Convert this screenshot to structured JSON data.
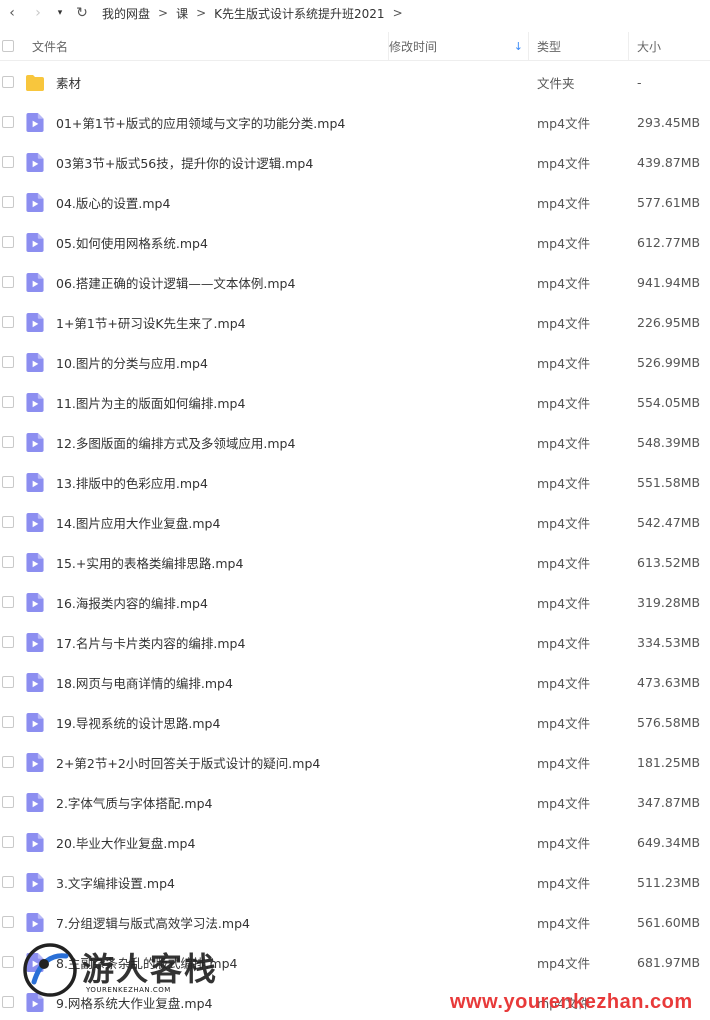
{
  "nav": {
    "back_glyph": "‹",
    "forward_glyph": "›",
    "dropdown_glyph": "▾",
    "refresh_glyph": "↻",
    "breadcrumbs": [
      "我的网盘",
      "课",
      "K先生版式设计系统提升班2021"
    ],
    "separator": ">"
  },
  "header": {
    "name": "文件名",
    "date": "修改时间",
    "type": "类型",
    "size": "大小",
    "sort_glyph": "↓"
  },
  "colors": {
    "folder": "#f8c63d",
    "video_icon": "#8c8ef0",
    "accent": "#3b8bf6",
    "watermark_red": "#e83a3a"
  },
  "files": [
    {
      "name": "素材",
      "type": "文件夹",
      "size": "-",
      "icon": "folder-icon"
    },
    {
      "name": "01+第1节+版式的应用领域与文字的功能分类.mp4",
      "type": "mp4文件",
      "size": "293.45MB",
      "icon": "video-file-icon"
    },
    {
      "name": "03第3节+版式56技，提升你的设计逻辑.mp4",
      "type": "mp4文件",
      "size": "439.87MB",
      "icon": "video-file-icon"
    },
    {
      "name": "04.版心的设置.mp4",
      "type": "mp4文件",
      "size": "577.61MB",
      "icon": "video-file-icon"
    },
    {
      "name": "05.如何使用网格系统.mp4",
      "type": "mp4文件",
      "size": "612.77MB",
      "icon": "video-file-icon"
    },
    {
      "name": "06.搭建正确的设计逻辑——文本体例.mp4",
      "type": "mp4文件",
      "size": "941.94MB",
      "icon": "video-file-icon"
    },
    {
      "name": "1+第1节+研习设K先生来了.mp4",
      "type": "mp4文件",
      "size": "226.95MB",
      "icon": "video-file-icon"
    },
    {
      "name": "10.图片的分类与应用.mp4",
      "type": "mp4文件",
      "size": "526.99MB",
      "icon": "video-file-icon"
    },
    {
      "name": "11.图片为主的版面如何编排.mp4",
      "type": "mp4文件",
      "size": "554.05MB",
      "icon": "video-file-icon"
    },
    {
      "name": "12.多图版面的编排方式及多领域应用.mp4",
      "type": "mp4文件",
      "size": "548.39MB",
      "icon": "video-file-icon"
    },
    {
      "name": "13.排版中的色彩应用.mp4",
      "type": "mp4文件",
      "size": "551.58MB",
      "icon": "video-file-icon"
    },
    {
      "name": "14.图片应用大作业复盘.mp4",
      "type": "mp4文件",
      "size": "542.47MB",
      "icon": "video-file-icon"
    },
    {
      "name": "15.+实用的表格类编排思路.mp4",
      "type": "mp4文件",
      "size": "613.52MB",
      "icon": "video-file-icon"
    },
    {
      "name": "16.海报类内容的编排.mp4",
      "type": "mp4文件",
      "size": "319.28MB",
      "icon": "video-file-icon"
    },
    {
      "name": "17.名片与卡片类内容的编排.mp4",
      "type": "mp4文件",
      "size": "334.53MB",
      "icon": "video-file-icon"
    },
    {
      "name": "18.网页与电商详情的编排.mp4",
      "type": "mp4文件",
      "size": "473.63MB",
      "icon": "video-file-icon"
    },
    {
      "name": "19.导视系统的设计思路.mp4",
      "type": "mp4文件",
      "size": "576.58MB",
      "icon": "video-file-icon"
    },
    {
      "name": "2+第2节+2小时回答关于版式设计的疑问.mp4",
      "type": "mp4文件",
      "size": "181.25MB",
      "icon": "video-file-icon"
    },
    {
      "name": "2.字体气质与字体搭配.mp4",
      "type": "mp4文件",
      "size": "347.87MB",
      "icon": "video-file-icon"
    },
    {
      "name": "20.毕业大作业复盘.mp4",
      "type": "mp4文件",
      "size": "649.34MB",
      "icon": "video-file-icon"
    },
    {
      "name": "3.文字编排设置.mp4",
      "type": "mp4文件",
      "size": "511.23MB",
      "icon": "video-file-icon"
    },
    {
      "name": "7.分组逻辑与版式高效学习法.mp4",
      "type": "mp4文件",
      "size": "561.60MB",
      "icon": "video-file-icon"
    },
    {
      "name": "8.主副杂条杂乱的版式编排.mp4",
      "type": "mp4文件",
      "size": "681.97MB",
      "icon": "video-file-icon"
    },
    {
      "name": "9.网格系统大作业复盘.mp4",
      "type": "mp4文件",
      "size": "",
      "icon": "video-file-icon"
    }
  ],
  "watermark": {
    "title": "游人客栈",
    "subtitle": "YOURENKEZHAN.COM",
    "url": "www.yourenkezhan.com"
  }
}
